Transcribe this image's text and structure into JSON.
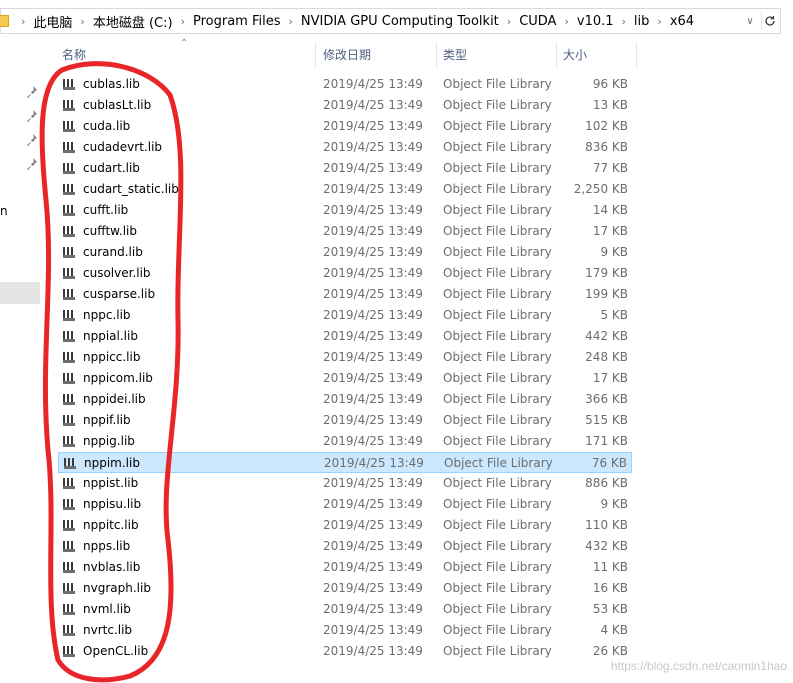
{
  "address_bar": {
    "crumbs": [
      "此电脑",
      "本地磁盘 (C:)",
      "Program Files",
      "NVIDIA GPU Computing Toolkit",
      "CUDA",
      "v10.1",
      "lib",
      "x64"
    ]
  },
  "nav_fragment_text": "n",
  "columns": {
    "name": "名称",
    "modified": "修改日期",
    "type": "类型",
    "size": "大小"
  },
  "files": [
    {
      "name": "cublas.lib",
      "date": "2019/4/25 13:49",
      "type": "Object File Library",
      "size": "96 KB"
    },
    {
      "name": "cublasLt.lib",
      "date": "2019/4/25 13:49",
      "type": "Object File Library",
      "size": "13 KB"
    },
    {
      "name": "cuda.lib",
      "date": "2019/4/25 13:49",
      "type": "Object File Library",
      "size": "102 KB"
    },
    {
      "name": "cudadevrt.lib",
      "date": "2019/4/25 13:49",
      "type": "Object File Library",
      "size": "836 KB"
    },
    {
      "name": "cudart.lib",
      "date": "2019/4/25 13:49",
      "type": "Object File Library",
      "size": "77 KB"
    },
    {
      "name": "cudart_static.lib",
      "date": "2019/4/25 13:49",
      "type": "Object File Library",
      "size": "2,250 KB"
    },
    {
      "name": "cufft.lib",
      "date": "2019/4/25 13:49",
      "type": "Object File Library",
      "size": "14 KB"
    },
    {
      "name": "cufftw.lib",
      "date": "2019/4/25 13:49",
      "type": "Object File Library",
      "size": "17 KB"
    },
    {
      "name": "curand.lib",
      "date": "2019/4/25 13:49",
      "type": "Object File Library",
      "size": "9 KB"
    },
    {
      "name": "cusolver.lib",
      "date": "2019/4/25 13:49",
      "type": "Object File Library",
      "size": "179 KB"
    },
    {
      "name": "cusparse.lib",
      "date": "2019/4/25 13:49",
      "type": "Object File Library",
      "size": "199 KB"
    },
    {
      "name": "nppc.lib",
      "date": "2019/4/25 13:49",
      "type": "Object File Library",
      "size": "5 KB"
    },
    {
      "name": "nppial.lib",
      "date": "2019/4/25 13:49",
      "type": "Object File Library",
      "size": "442 KB"
    },
    {
      "name": "nppicc.lib",
      "date": "2019/4/25 13:49",
      "type": "Object File Library",
      "size": "248 KB"
    },
    {
      "name": "nppicom.lib",
      "date": "2019/4/25 13:49",
      "type": "Object File Library",
      "size": "17 KB"
    },
    {
      "name": "nppidei.lib",
      "date": "2019/4/25 13:49",
      "type": "Object File Library",
      "size": "366 KB"
    },
    {
      "name": "nppif.lib",
      "date": "2019/4/25 13:49",
      "type": "Object File Library",
      "size": "515 KB"
    },
    {
      "name": "nppig.lib",
      "date": "2019/4/25 13:49",
      "type": "Object File Library",
      "size": "171 KB"
    },
    {
      "name": "nppim.lib",
      "date": "2019/4/25 13:49",
      "type": "Object File Library",
      "size": "76 KB",
      "selected": true
    },
    {
      "name": "nppist.lib",
      "date": "2019/4/25 13:49",
      "type": "Object File Library",
      "size": "886 KB"
    },
    {
      "name": "nppisu.lib",
      "date": "2019/4/25 13:49",
      "type": "Object File Library",
      "size": "9 KB"
    },
    {
      "name": "nppitc.lib",
      "date": "2019/4/25 13:49",
      "type": "Object File Library",
      "size": "110 KB"
    },
    {
      "name": "npps.lib",
      "date": "2019/4/25 13:49",
      "type": "Object File Library",
      "size": "432 KB"
    },
    {
      "name": "nvblas.lib",
      "date": "2019/4/25 13:49",
      "type": "Object File Library",
      "size": "11 KB"
    },
    {
      "name": "nvgraph.lib",
      "date": "2019/4/25 13:49",
      "type": "Object File Library",
      "size": "16 KB"
    },
    {
      "name": "nvml.lib",
      "date": "2019/4/25 13:49",
      "type": "Object File Library",
      "size": "53 KB"
    },
    {
      "name": "nvrtc.lib",
      "date": "2019/4/25 13:49",
      "type": "Object File Library",
      "size": "4 KB"
    },
    {
      "name": "OpenCL.lib",
      "date": "2019/4/25 13:49",
      "type": "Object File Library",
      "size": "26 KB"
    }
  ],
  "watermark": "https://blog.csdn.net/caomin1hao",
  "colors": {
    "selection_bg": "#cce8ff",
    "selection_border": "#99d1ff",
    "header_text": "#4d6082",
    "annotation": "#e8262a"
  },
  "icons": {
    "address_folder": "folder-icon",
    "file": "lib-file-icon",
    "pin": "pin-icon",
    "refresh": "refresh-icon"
  }
}
